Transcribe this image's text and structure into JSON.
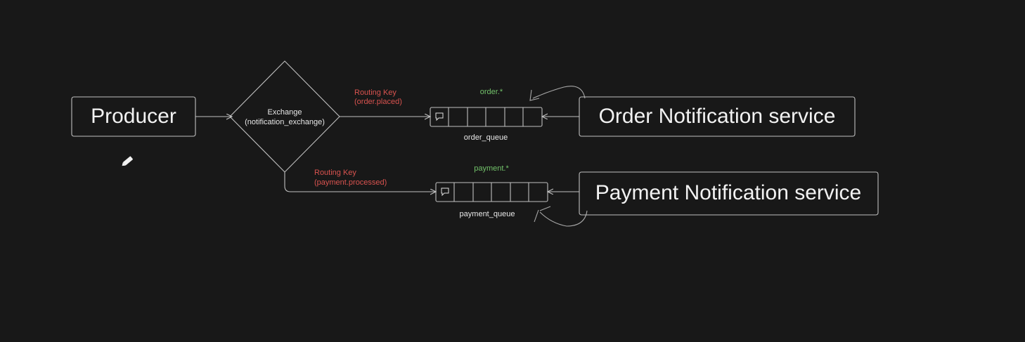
{
  "producer": {
    "label": "Producer"
  },
  "exchange": {
    "line1": "Exchange",
    "line2": "(notification_exchange)"
  },
  "order_route": {
    "routing_key_label": "Routing Key",
    "routing_key_value": "(order.placed)",
    "binding_pattern": "order.*",
    "queue_name": "order_queue"
  },
  "payment_route": {
    "routing_key_label": "Routing Key",
    "routing_key_value": "(payment.processed)",
    "binding_pattern": "payment.*",
    "queue_name": "payment_queue"
  },
  "order_service": {
    "label": "Order Notification service"
  },
  "payment_service": {
    "label": "Payment Notification service"
  },
  "icons": {
    "queue_message": "message-icon",
    "cursor": "pencil-icon"
  },
  "colors": {
    "background": "#181818",
    "routing_key": "#d9534f",
    "binding_pattern": "#72c26a",
    "text": "#f2f2f2"
  }
}
